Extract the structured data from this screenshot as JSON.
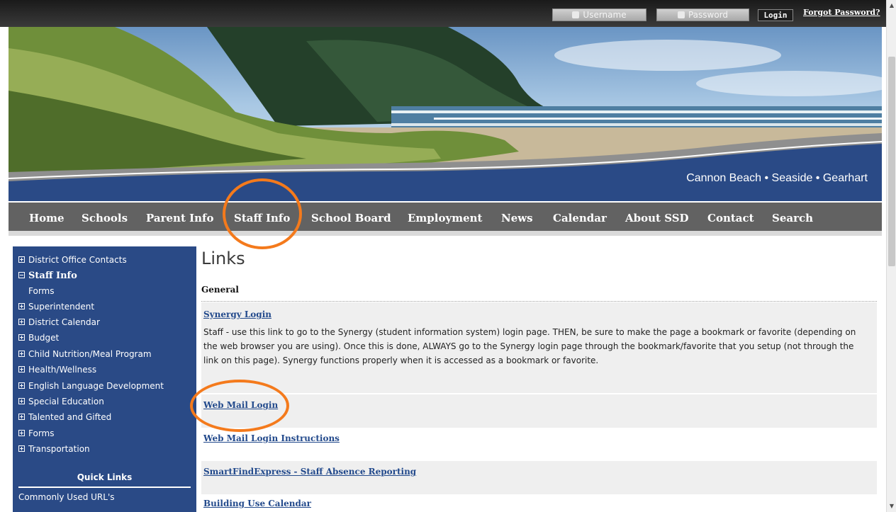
{
  "topbar": {
    "username_placeholder": "Username",
    "password_placeholder": "Password",
    "login_label": "Login",
    "forgot_label": "Forgot Password?"
  },
  "banner": {
    "cities": "Cannon Beach • Seaside • Gearhart"
  },
  "nav": {
    "items": [
      "Home",
      "Schools",
      "Parent Info",
      "Staff Info",
      "School Board",
      "Employment",
      "News",
      "Calendar",
      "About SSD",
      "Contact",
      "Search"
    ],
    "active": "Staff Info"
  },
  "sidebar": {
    "items": [
      {
        "label": "District Office Contacts"
      },
      {
        "label": "Staff Info"
      },
      {
        "label": "Forms"
      },
      {
        "label": "Superintendent"
      },
      {
        "label": "District Calendar"
      },
      {
        "label": "Budget"
      },
      {
        "label": "Child Nutrition/Meal Program"
      },
      {
        "label": "Health/Wellness"
      },
      {
        "label": "English Language Development"
      },
      {
        "label": "Special Education"
      },
      {
        "label": "Talented and Gifted"
      },
      {
        "label": "Forms"
      },
      {
        "label": "Transportation"
      }
    ],
    "quick_links_title": "Quick Links",
    "quick_links": [
      "Commonly Used URL's"
    ]
  },
  "content": {
    "heading": "Links",
    "section": "General",
    "links": [
      {
        "title": "Synergy Login",
        "description": "Staff - use this link to go to the Synergy (student information system) login page.  THEN, be sure to make the page a bookmark or favorite (depending on the web browser you are using).  Once this is done, ALWAYS go to the Synergy login page through the bookmark/favorite that you setup (not through the link on this page).  Synergy functions properly when it is accessed as a bookmark or favorite."
      },
      {
        "title": "Web Mail Login"
      },
      {
        "title": "Web Mail Login Instructions"
      },
      {
        "title": "SmartFindExpress - Staff Absence Reporting"
      },
      {
        "title": "Building Use Calendar"
      }
    ]
  },
  "colors": {
    "brand_blue": "#2a4a86",
    "nav_gray": "#626262",
    "link_blue": "#234a8c",
    "highlight_orange": "#f47a1c"
  }
}
